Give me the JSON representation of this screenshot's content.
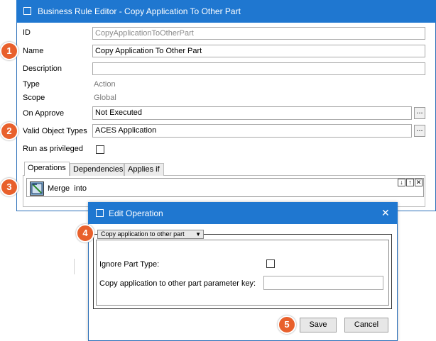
{
  "main_window": {
    "title": "Business Rule Editor - Copy Application To Other Part",
    "fields": {
      "id_label": "ID",
      "id_value": "CopyApplicationToOtherPart",
      "name_label": "Name",
      "name_value": "Copy Application To Other Part",
      "description_label": "Description",
      "description_value": "",
      "type_label": "Type",
      "type_value": "Action",
      "scope_label": "Scope",
      "scope_value": "Global",
      "on_approve_label": "On Approve",
      "on_approve_value": "Not Executed",
      "valid_object_types_label": "Valid Object Types",
      "valid_object_types_value": "ACES Application",
      "run_as_privileged_label": "Run as privileged",
      "browse_label": "..."
    },
    "tabs": [
      {
        "label": "Operations"
      },
      {
        "label": "Dependencies"
      },
      {
        "label": "Applies if"
      }
    ],
    "operations": {
      "item_label": "Merge  into",
      "move_down": "↓",
      "move_up": "↑",
      "remove": "✕"
    }
  },
  "edit_dialog": {
    "title": "Edit Operation",
    "close": "✕",
    "operation_select": "Copy application to other part",
    "ignore_part_type_label": "Ignore Part Type:",
    "parameter_key_label": "Copy application to other part parameter key:",
    "parameter_key_value": "",
    "save_label": "Save",
    "cancel_label": "Cancel"
  },
  "callouts": [
    "1",
    "2",
    "3",
    "4",
    "5"
  ],
  "colors": {
    "title_bar": "#1f77d0",
    "callout": "#e8602c"
  }
}
